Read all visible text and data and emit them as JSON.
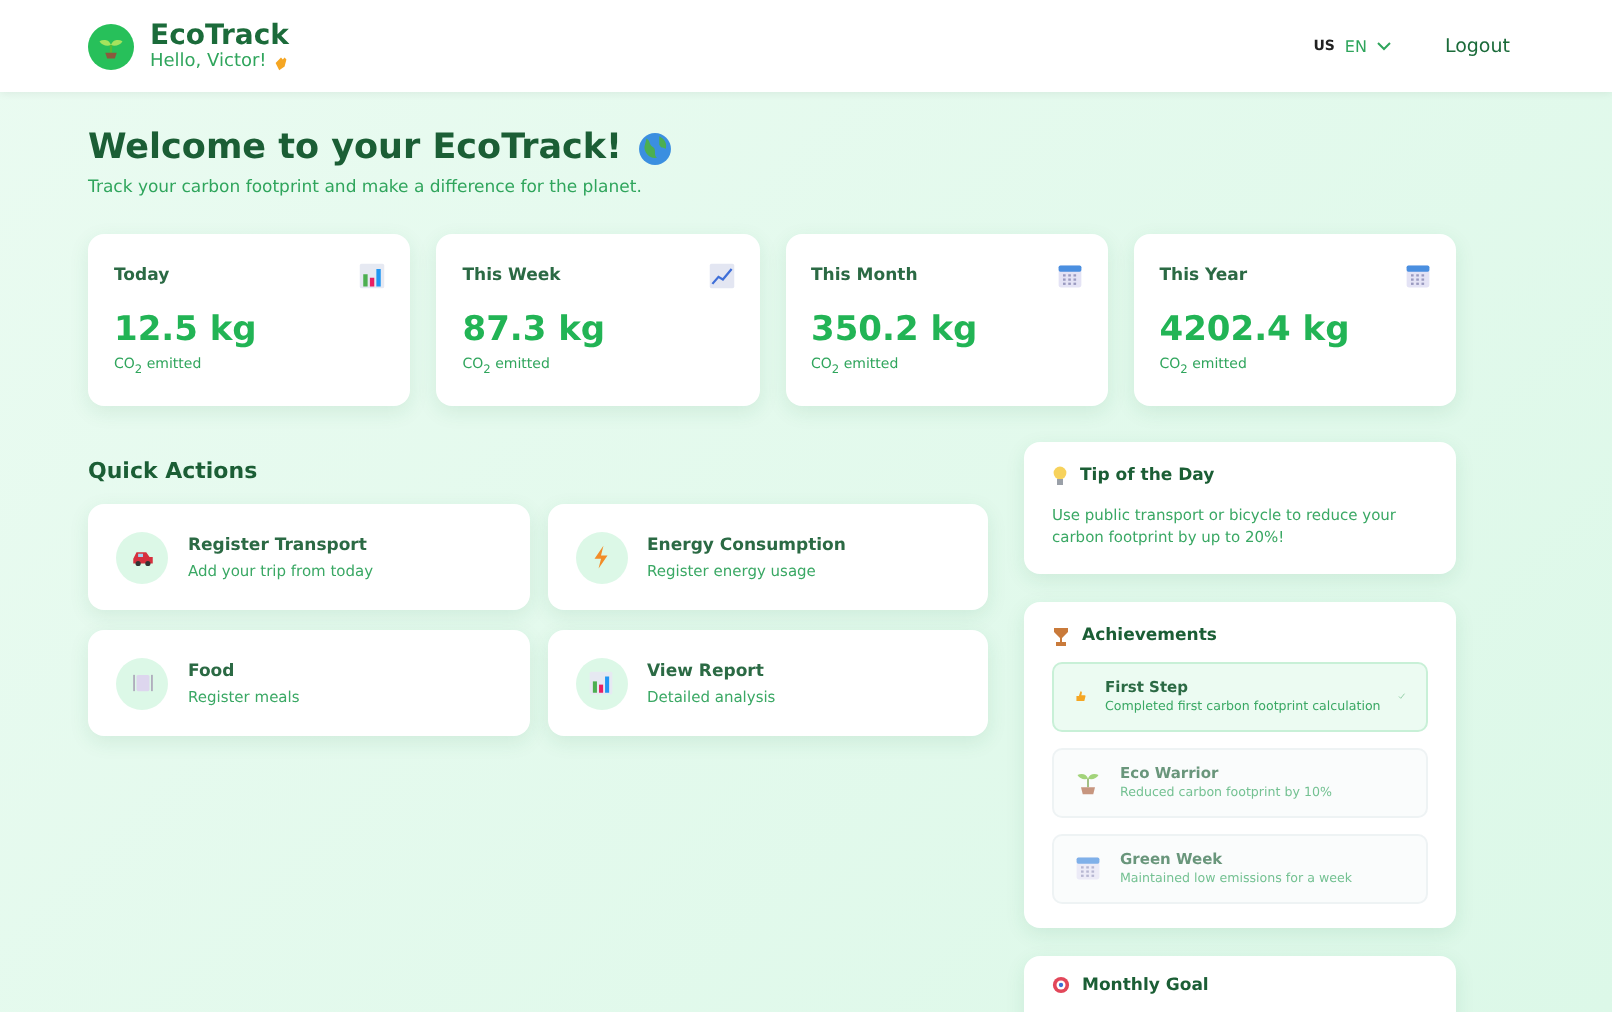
{
  "header": {
    "brand": "EcoTrack",
    "greeting": "Hello, Victor!",
    "language": {
      "flag": "US",
      "code": "EN"
    },
    "logout": "Logout"
  },
  "welcome": {
    "title": "Welcome to your EcoTrack!",
    "subtitle": "Track your carbon footprint and make a difference for the planet."
  },
  "stats": [
    {
      "label": "Today",
      "value": "12.5 kg",
      "unit": "CO$_{2}$ emitted",
      "kind": "bars"
    },
    {
      "label": "This Week",
      "value": "87.3 kg",
      "unit": "CO$_{2}$ emitted",
      "kind": "trend"
    },
    {
      "label": "This Month",
      "value": "350.2 kg",
      "unit": "CO$_{2}$ emitted",
      "kind": "calendar"
    },
    {
      "label": "This Year",
      "value": "4202.4 kg",
      "unit": "CO$_{2}$ emitted",
      "kind": "calendar"
    }
  ],
  "quick_actions": {
    "title": "Quick Actions",
    "items": [
      {
        "title": "Register Transport",
        "subtitle": "Add your trip from today",
        "kind": "car"
      },
      {
        "title": "Energy Consumption",
        "subtitle": "Register energy usage",
        "kind": "bolt"
      },
      {
        "title": "Food",
        "subtitle": "Register meals",
        "kind": "plate"
      },
      {
        "title": "View Report",
        "subtitle": "Detailed analysis",
        "kind": "bars"
      }
    ]
  },
  "tip": {
    "title": "Tip of the Day",
    "text": "Use public transport or bicycle to reduce your carbon footprint by up to 20%!"
  },
  "achievements": {
    "title": "Achievements",
    "items": [
      {
        "title": "First Step",
        "subtitle": "Completed first carbon footprint calculation",
        "kind": "thumb",
        "achieved": true
      },
      {
        "title": "Eco Warrior",
        "subtitle": "Reduced carbon footprint by 10%",
        "kind": "sprout",
        "achieved": false
      },
      {
        "title": "Green Week",
        "subtitle": "Maintained low emissions for a week",
        "kind": "calendar",
        "achieved": false
      }
    ]
  },
  "monthly_goal": {
    "title": "Monthly Goal"
  }
}
